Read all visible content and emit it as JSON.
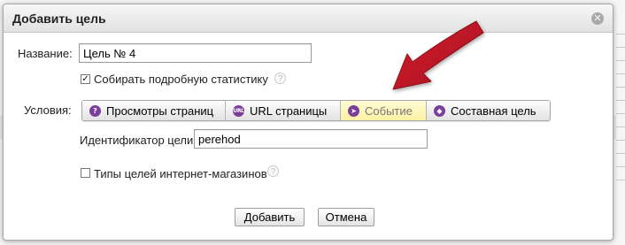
{
  "dialog": {
    "title": "Добавить цель",
    "close_symbol": "✕"
  },
  "form": {
    "name_label": "Название:",
    "name_value": "Цель № 4",
    "detailed_stats_label": "Собирать подробную статистику",
    "detailed_stats_checked": true,
    "conditions_label": "Условия:",
    "tabs": [
      {
        "label": "Просмотры страниц",
        "icon": "pageviews-icon",
        "glyph": "?"
      },
      {
        "label": "URL страницы",
        "icon": "url-icon",
        "glyph": "URL"
      },
      {
        "label": "Событие",
        "icon": "event-icon",
        "glyph": "➤",
        "active": true
      },
      {
        "label": "Составная цель",
        "icon": "composite-icon",
        "glyph": "◆"
      }
    ],
    "goal_id_label": "Идентификатор цели:",
    "goal_id_value": "perehod",
    "shop_goals_label": "Типы целей интернет-магазинов",
    "shop_goals_checked": false,
    "help_symbol": "?"
  },
  "buttons": {
    "add": "Добавить",
    "cancel": "Отмена"
  },
  "colors": {
    "tab_icon": "#7b3e9b",
    "active_tab": "#fdf1a2",
    "arrow": "#c0182a"
  }
}
